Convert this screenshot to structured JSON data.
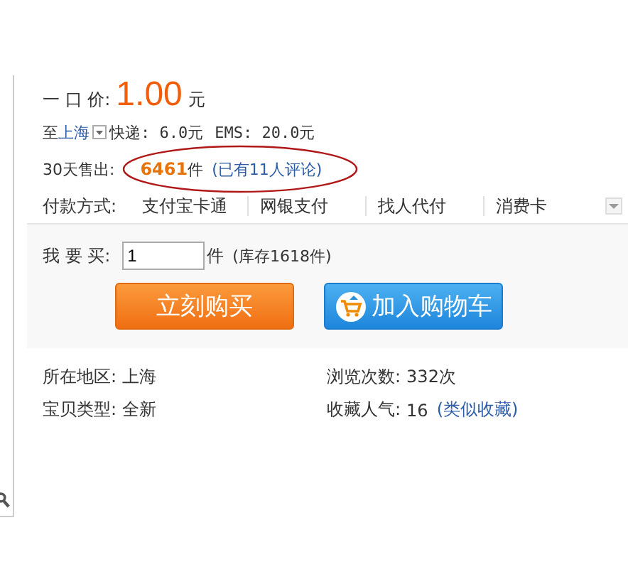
{
  "price": {
    "label": "一 口 价:",
    "amount": "1.00",
    "unit": "元"
  },
  "shipping": {
    "prefix": "至",
    "city": "上海",
    "express": "快递: 6.0元",
    "ems": "EMS: 20.0元"
  },
  "sales": {
    "label": "30天售出:",
    "count": "6461",
    "unit": "件",
    "reviews": "(已有11人评论)"
  },
  "payment": {
    "label": "付款方式:",
    "methods": [
      "支付宝卡通",
      "网银支付",
      "找人代付",
      "消费卡"
    ]
  },
  "purchase": {
    "label": "我 要 买:",
    "quantity": "1",
    "unit": "件",
    "stock": "(库存1618件)",
    "buttons": [
      {
        "label": "立刻购买",
        "kind": "buy"
      },
      {
        "label": "加入购物车",
        "kind": "cart"
      }
    ]
  },
  "info": [
    {
      "label": "所在地区:",
      "value": "上海"
    },
    {
      "label": "浏览次数:",
      "value": "332次"
    },
    {
      "label": "宝贝类型:",
      "value": "全新"
    },
    {
      "label": "收藏人气:",
      "value": "16",
      "link": "(类似收藏)"
    }
  ]
}
